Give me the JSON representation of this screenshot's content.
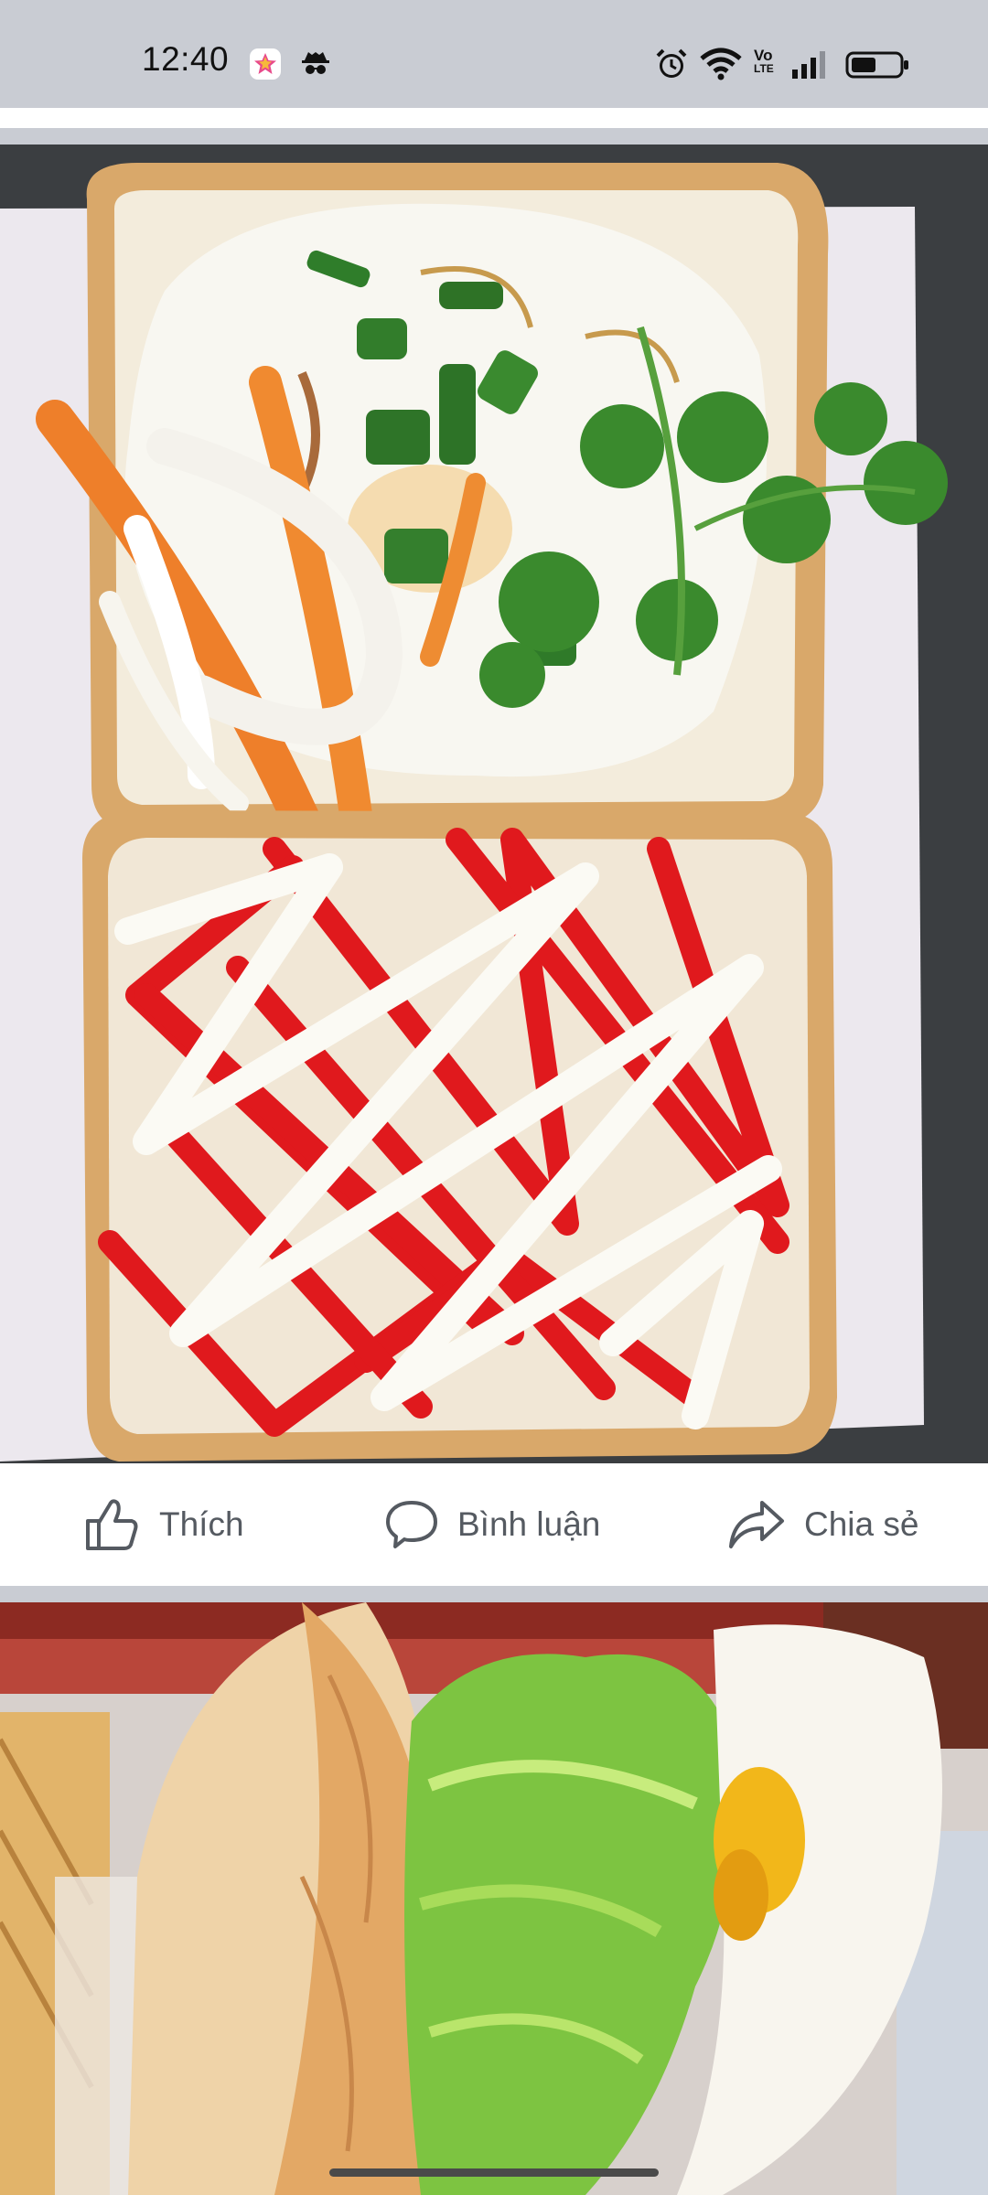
{
  "status_bar": {
    "time": "12:40",
    "icons": [
      "app-star-icon",
      "incognito-icon",
      "alarm-icon",
      "wifi-icon",
      "volte-icon",
      "signal-icon",
      "battery-icon"
    ],
    "volte_text_top": "Vo",
    "volte_text_bottom": "LTE"
  },
  "post_1": {
    "image_subject": "toast-with-fried-egg-and-ketchup-mayo",
    "actions": {
      "like_label": "Thích",
      "comment_label": "Bình luận",
      "share_label": "Chia sẻ"
    }
  },
  "post_2": {
    "image_subject": "banh-mi-with-lettuce-and-egg"
  },
  "colors": {
    "status_bg": "#c9ccd3",
    "card_bg": "#ffffff",
    "action_text": "#555a61"
  }
}
